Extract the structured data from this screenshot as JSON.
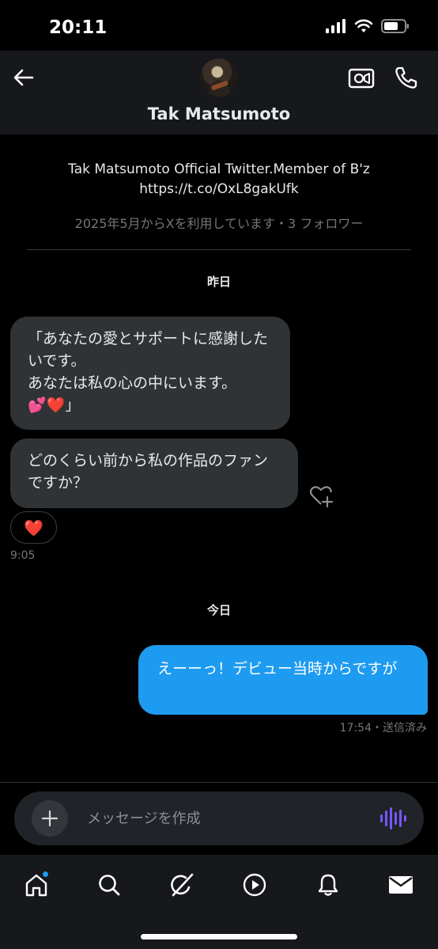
{
  "status_bar": {
    "time": "20:11"
  },
  "header": {
    "name": "Tak Matsumoto"
  },
  "profile": {
    "bio_line1": "Tak Matsumoto Official Twitter.Member of B'z",
    "bio_line2": "https://t.co/OxL8gakUfk",
    "meta": "2025年5月からXを利用しています・3 フォロワー"
  },
  "dates": {
    "yesterday": "昨日",
    "today": "今日"
  },
  "messages": [
    {
      "direction": "in",
      "text": "「あなたの愛とサポートに感謝したいです。\nあなたは私の心の中にいます。\n💕❤️」"
    },
    {
      "direction": "in",
      "text": "どのくらい前から私の作品のファンですか？",
      "reaction": "❤️",
      "time": "9:05"
    },
    {
      "direction": "out",
      "text": "えーーっ！デビュー当時からですが",
      "status": "17:54・送信済み"
    }
  ],
  "composer": {
    "placeholder": "メッセージを作成"
  },
  "tabs": [
    {
      "icon": "home-icon",
      "badge": true
    },
    {
      "icon": "search-icon"
    },
    {
      "icon": "grok-icon"
    },
    {
      "icon": "video-play-icon"
    },
    {
      "icon": "bell-icon"
    },
    {
      "icon": "mail-icon"
    }
  ],
  "colors": {
    "accent": "#1d9bf0",
    "incoming_bubble": "#2f3336",
    "voice_icon": "#7856ff"
  }
}
